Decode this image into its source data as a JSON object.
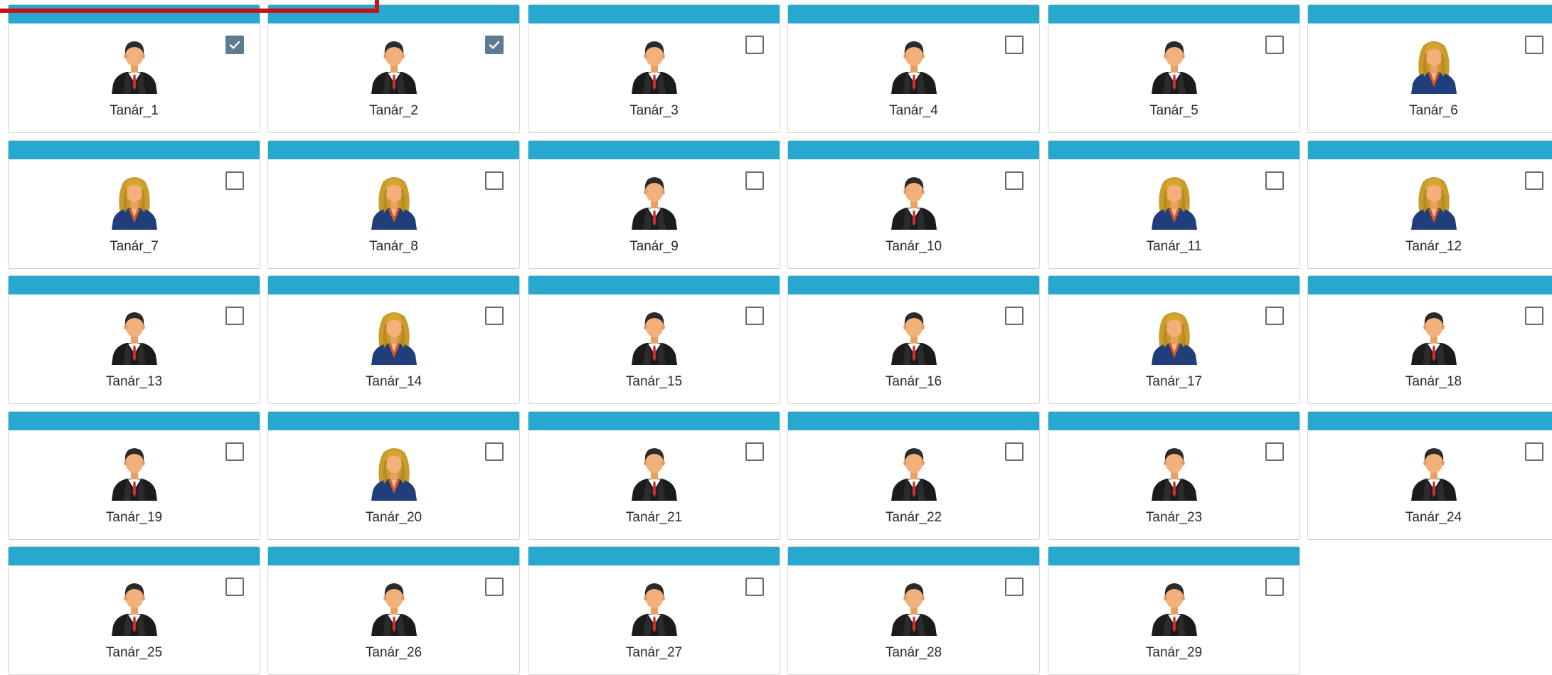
{
  "colors": {
    "card_header": "#27a8ce",
    "checkbox_checked": "#5e7c8f",
    "selection_frame": "#c8101a"
  },
  "teachers": [
    {
      "name": "Tanár_1",
      "avatar": "male-teacher-icon",
      "checked": true
    },
    {
      "name": "Tanár_2",
      "avatar": "male-teacher-icon",
      "checked": true
    },
    {
      "name": "Tanár_3",
      "avatar": "male-teacher-icon",
      "checked": false
    },
    {
      "name": "Tanár_4",
      "avatar": "male-teacher-icon",
      "checked": false
    },
    {
      "name": "Tanár_5",
      "avatar": "male-teacher-icon",
      "checked": false
    },
    {
      "name": "Tanár_6",
      "avatar": "female-teacher-icon",
      "checked": false
    },
    {
      "name": "Tanár_7",
      "avatar": "female-teacher-icon",
      "checked": false
    },
    {
      "name": "Tanár_8",
      "avatar": "female-teacher-icon",
      "checked": false
    },
    {
      "name": "Tanár_9",
      "avatar": "male-teacher-icon",
      "checked": false
    },
    {
      "name": "Tanár_10",
      "avatar": "male-teacher-icon",
      "checked": false
    },
    {
      "name": "Tanár_11",
      "avatar": "female-teacher-icon",
      "checked": false
    },
    {
      "name": "Tanár_12",
      "avatar": "female-teacher-icon",
      "checked": false
    },
    {
      "name": "Tanár_13",
      "avatar": "male-teacher-icon",
      "checked": false
    },
    {
      "name": "Tanár_14",
      "avatar": "female-teacher-icon",
      "checked": false
    },
    {
      "name": "Tanár_15",
      "avatar": "male-teacher-icon",
      "checked": false
    },
    {
      "name": "Tanár_16",
      "avatar": "male-teacher-icon",
      "checked": false
    },
    {
      "name": "Tanár_17",
      "avatar": "female-teacher-icon",
      "checked": false
    },
    {
      "name": "Tanár_18",
      "avatar": "male-teacher-icon",
      "checked": false
    },
    {
      "name": "Tanár_19",
      "avatar": "male-teacher-icon",
      "checked": false
    },
    {
      "name": "Tanár_20",
      "avatar": "female-teacher-icon",
      "checked": false
    },
    {
      "name": "Tanár_21",
      "avatar": "male-teacher-icon",
      "checked": false
    },
    {
      "name": "Tanár_22",
      "avatar": "male-teacher-icon",
      "checked": false
    },
    {
      "name": "Tanár_23",
      "avatar": "male-teacher-icon",
      "checked": false
    },
    {
      "name": "Tanár_24",
      "avatar": "male-teacher-icon",
      "checked": false
    },
    {
      "name": "Tanár_25",
      "avatar": "male-teacher-icon",
      "checked": false
    },
    {
      "name": "Tanár_26",
      "avatar": "male-teacher-icon",
      "checked": false
    },
    {
      "name": "Tanár_27",
      "avatar": "male-teacher-icon",
      "checked": false
    },
    {
      "name": "Tanár_28",
      "avatar": "male-teacher-icon",
      "checked": false
    },
    {
      "name": "Tanár_29",
      "avatar": "male-teacher-icon",
      "checked": false
    }
  ]
}
